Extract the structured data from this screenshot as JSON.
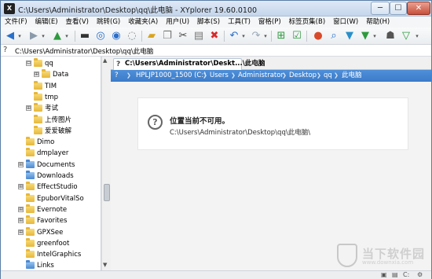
{
  "window": {
    "title": "C:\\Users\\Administrator\\Desktop\\qq\\此电脑 - XYplorer 19.60.0100",
    "app_icon": "X",
    "min": "─",
    "max": "☐",
    "close": "✕"
  },
  "menu": [
    "文件(F)",
    "编辑(E)",
    "查看(V)",
    "跳转(G)",
    "收藏夹(A)",
    "用户(U)",
    "脚本(S)",
    "工具(T)",
    "窗格(P)",
    "标签页集(B)",
    "窗口(W)",
    "帮助(H)"
  ],
  "toolbar_icons": [
    "back-icon",
    "forward-icon",
    "up-icon",
    "computer-icon",
    "target-icon",
    "search-icon",
    "refresh-icon",
    "new-folder-icon",
    "copy-icon",
    "cut-icon",
    "paste-icon",
    "delete-icon",
    "undo-icon",
    "redo-icon",
    "tree-icon",
    "checklist-icon",
    "palette-icon",
    "find-icon",
    "filter-icon",
    "filter2-icon",
    "ghost-icon",
    "menu-icon"
  ],
  "address": {
    "path": "C:\\Users\\Administrator\\Desktop\\qq\\此电脑"
  },
  "tree": [
    {
      "label": "qq",
      "indent": 3,
      "expander": "⊟"
    },
    {
      "label": "Data",
      "indent": 4,
      "expander": "⊞"
    },
    {
      "label": "TIM",
      "indent": 3,
      "expander": ""
    },
    {
      "label": "tmp",
      "indent": 3,
      "expander": ""
    },
    {
      "label": "考试",
      "indent": 3,
      "expander": "⊞"
    },
    {
      "label": "上传图片",
      "indent": 3,
      "expander": ""
    },
    {
      "label": "爱爱破解",
      "indent": 3,
      "expander": ""
    },
    {
      "label": "Dimo",
      "indent": 2,
      "expander": ""
    },
    {
      "label": "dmplayer",
      "indent": 2,
      "expander": ""
    },
    {
      "label": "Documents",
      "indent": 2,
      "expander": "⊞",
      "special": true
    },
    {
      "label": "Downloads",
      "indent": 2,
      "expander": "",
      "special": true
    },
    {
      "label": "EffectStudio",
      "indent": 2,
      "expander": "⊞"
    },
    {
      "label": "EpuborVitalSo",
      "indent": 2,
      "expander": ""
    },
    {
      "label": "Evernote",
      "indent": 2,
      "expander": "⊞"
    },
    {
      "label": "Favorites",
      "indent": 2,
      "expander": "⊞"
    },
    {
      "label": "GPXSee",
      "indent": 2,
      "expander": "⊞"
    },
    {
      "label": "greenfoot",
      "indent": 2,
      "expander": ""
    },
    {
      "label": "IntelGraphics",
      "indent": 2,
      "expander": ""
    },
    {
      "label": "Links",
      "indent": 2,
      "expander": "",
      "special": true
    }
  ],
  "tab": {
    "label": "C:\\Users\\Administrator\\Deskt...\\此电脑",
    "add": "+",
    "dropdown": "▾"
  },
  "breadcrumb": [
    "HPLJP1000_1500 (C:)",
    "Users",
    "Administrator",
    "Desktop",
    "qq",
    "此电脑"
  ],
  "message": {
    "title": "位置当前不可用。",
    "path": "C:\\Users\\Administrator\\Desktop\\qq\\此电脑\\"
  },
  "watermark": {
    "line1": "当下软件园",
    "line2": "www.downxia.com"
  },
  "status_icons": [
    "lock-icon",
    "save-icon",
    "c-drive-icon",
    "settings-icon"
  ]
}
